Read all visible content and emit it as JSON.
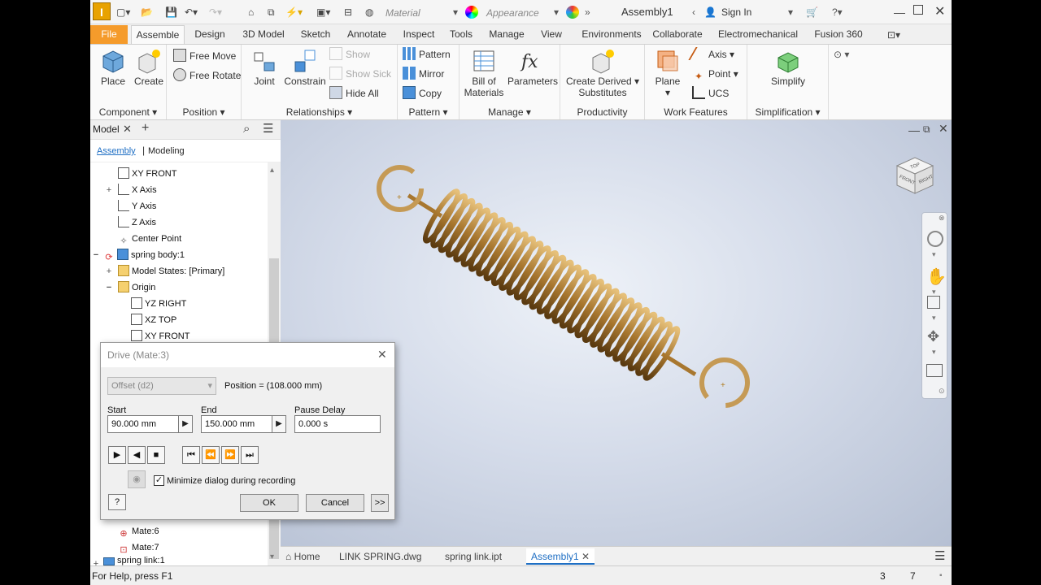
{
  "titlebar": {
    "logo": "I",
    "material": "Material",
    "appearance": "Appearance",
    "doc_title": "Assembly1",
    "sign_in": "Sign In"
  },
  "tabs": [
    "File",
    "Assemble",
    "Design",
    "3D Model",
    "Sketch",
    "Annotate",
    "Inspect",
    "Tools",
    "Manage",
    "View",
    "Environments",
    "Collaborate",
    "Electromechanical",
    "Fusion 360"
  ],
  "active_tab": "Assemble",
  "ribbon": {
    "component": {
      "label": "Component",
      "place": "Place",
      "create": "Create"
    },
    "position": {
      "label": "Position",
      "free_move": "Free Move",
      "free_rotate": "Free Rotate"
    },
    "relationships": {
      "label": "Relationships",
      "joint": "Joint",
      "constrain": "Constrain",
      "show": "Show",
      "show_sick": "Show Sick",
      "hide_all": "Hide All"
    },
    "pattern": {
      "label": "Pattern",
      "pattern": "Pattern",
      "mirror": "Mirror",
      "copy": "Copy"
    },
    "manage": {
      "label": "Manage",
      "bom_1": "Bill of",
      "bom_2": "Materials",
      "parameters": "Parameters"
    },
    "productivity": {
      "label": "Productivity",
      "cds_1": "Create Derived",
      "cds_2": "Substitutes"
    },
    "work_features": {
      "label": "Work Features",
      "plane": "Plane",
      "axis": "Axis",
      "point": "Point",
      "ucs": "UCS"
    },
    "simplification": {
      "label": "Simplification",
      "simplify": "Simplify"
    }
  },
  "panel": {
    "title": "Model",
    "sub_assembly": "Assembly",
    "sub_modeling": "Modeling",
    "tree": [
      {
        "label": "XY  FRONT"
      },
      {
        "label": "X Axis"
      },
      {
        "label": "Y Axis"
      },
      {
        "label": "Z Axis"
      },
      {
        "label": "Center Point"
      },
      {
        "label": "spring body:1"
      },
      {
        "label": "Model States: [Primary]"
      },
      {
        "label": "Origin"
      },
      {
        "label": "YZ  RIGHT"
      },
      {
        "label": "XZ  TOP"
      },
      {
        "label": "XY  FRONT"
      }
    ],
    "tree_bottom": [
      {
        "label": "Mate:6"
      },
      {
        "label": "Mate:7"
      },
      {
        "label": "spring link:1"
      }
    ]
  },
  "dialog": {
    "title": "Drive (Mate:3)",
    "param": "Offset (d2)",
    "position": "Position = (108.000 mm)",
    "start_label": "Start",
    "start_value": "90.000 mm",
    "end_label": "End",
    "end_value": "150.000 mm",
    "pause_label": "Pause Delay",
    "pause_value": "0.000 s",
    "minimize_label": "Minimize dialog during recording",
    "ok": "OK",
    "cancel": "Cancel",
    "more": ">>"
  },
  "doctabs": [
    "Home",
    "LINK SPRING.dwg",
    "spring link.ipt",
    "Assembly1"
  ],
  "active_doc": "Assembly1",
  "status": {
    "help": "For Help, press F1",
    "count1": "3",
    "count2": "7"
  },
  "viewcube": {
    "front": "FRONT",
    "right": "RIGHT",
    "top": "TOP"
  },
  "colors": {
    "file_tab": "#f59b2b",
    "spring": "#a8772f",
    "accent": "#1f6fc4"
  }
}
